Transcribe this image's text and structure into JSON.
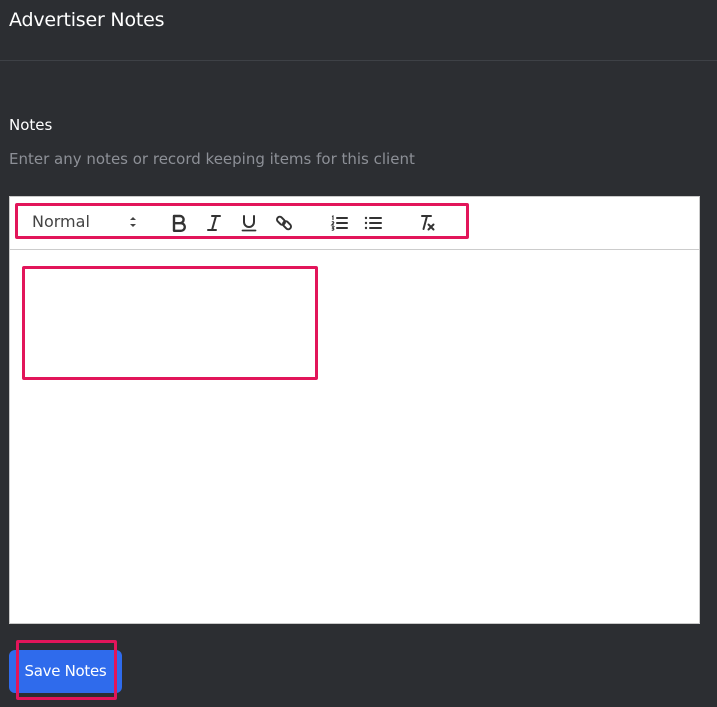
{
  "header": {
    "title": "Advertiser Notes"
  },
  "notes_field": {
    "label": "Notes",
    "help_text": "Enter any notes or record keeping items for this client",
    "content": ""
  },
  "toolbar": {
    "format_value": "Normal",
    "buttons": [
      {
        "name": "bold-icon"
      },
      {
        "name": "italic-icon"
      },
      {
        "name": "underline-icon"
      },
      {
        "name": "link-icon"
      },
      {
        "name": "ordered-list-icon"
      },
      {
        "name": "bullet-list-icon"
      },
      {
        "name": "clear-format-icon"
      }
    ]
  },
  "actions": {
    "save_label": "Save Notes"
  },
  "colors": {
    "background": "#2c2e32",
    "accent": "#2f6bec",
    "highlight": "#e2155a"
  }
}
